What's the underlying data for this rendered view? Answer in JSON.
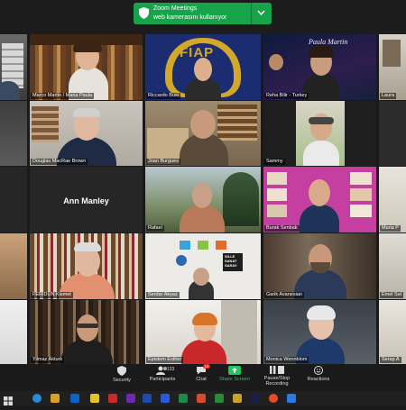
{
  "banner": {
    "title": "Zoom Meetings",
    "subtitle": "web kamerasını kullanıyor"
  },
  "participants": [
    {
      "name": "Marco Martin / Maria Paula"
    },
    {
      "name": "Riccardo Busi"
    },
    {
      "name": "Reha Bilir - Turkey"
    },
    {
      "name": "Laura"
    },
    {
      "name": "Douglas MacRae Brown"
    },
    {
      "name": "Joan Burgues"
    },
    {
      "name": "Sammy"
    },
    {
      "name": "Ann Manley"
    },
    {
      "name": "Rafael"
    },
    {
      "name": "Burak Senbak"
    },
    {
      "name": "Maria P"
    },
    {
      "name": "FERIDUN Kismet"
    },
    {
      "name": "Serdar Akyaz"
    },
    {
      "name": "Garik Avanesian"
    },
    {
      "name": "Emel Sel"
    },
    {
      "name": "Yilmaz Akturk"
    },
    {
      "name": "Epistem Esther"
    },
    {
      "name": "Monica Wennblom"
    },
    {
      "name": "Serap A"
    }
  ],
  "tile_texts": {
    "fiap": "FIAP",
    "paula": "Paula Martin",
    "sille1": "SILLE",
    "sille2": "SANAT",
    "sille3": "SARAY"
  },
  "toolbar": {
    "security": "Security",
    "participants": "Participants",
    "participants_count": "133",
    "chat": "Chat",
    "chat_badge": "16",
    "share": "Share Screen",
    "record": "Pause/Stop Recording",
    "reactions": "Reactions"
  },
  "colors": {
    "accent": "#16a34a",
    "active_speaker": "#f2c200"
  }
}
